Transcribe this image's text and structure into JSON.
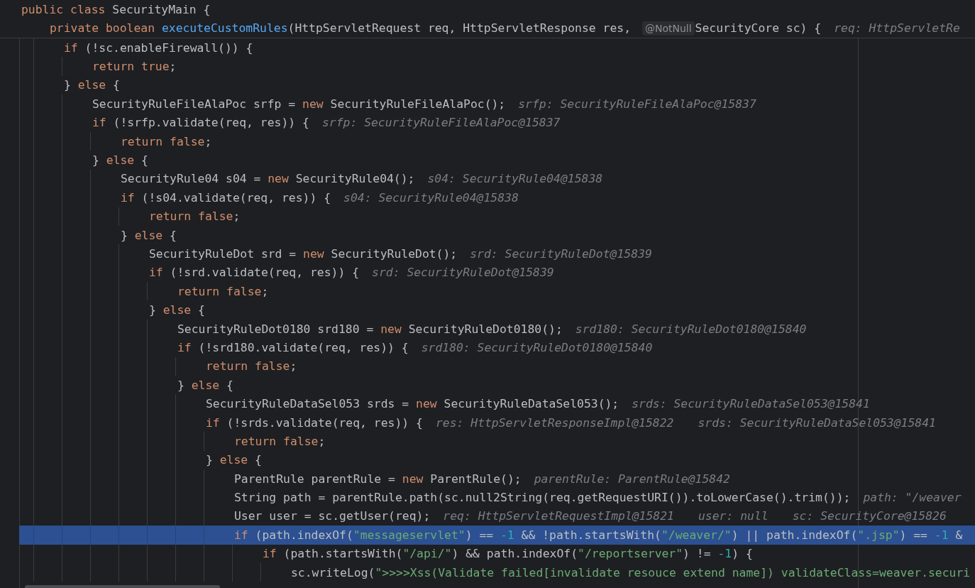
{
  "sticky_header": [
    {
      "segments": [
        {
          "kind": "code",
          "tokens": [
            {
              "kind": "kw",
              "text": "public class "
            },
            {
              "kind": "tx",
              "text": "SecurityMain {"
            }
          ]
        }
      ],
      "children": [
        {
          "segments": [
            {
              "kind": "code",
              "tokens": [
                {
                  "kind": "kw",
                  "text": "private boolean "
                },
                {
                  "kind": "fn",
                  "text": "executeCustomRules"
                },
                {
                  "kind": "tx",
                  "text": "(HttpServletRequest req, HttpServletResponse res, "
                }
              ]
            },
            {
              "kind": "inlay",
              "text": "@NotNull"
            },
            {
              "kind": "code",
              "tokens": [
                {
                  "kind": "tx",
                  "text": "SecurityCore sc) {"
                }
              ]
            },
            {
              "kind": "hint",
              "text": "req: HttpServletRe"
            }
          ]
        }
      ]
    }
  ],
  "lines": [
    {
      "selected": false,
      "segments": [
        {
          "kind": "code",
          "tokens": [
            {
              "kind": "kw",
              "text": "if "
            },
            {
              "kind": "tx",
              "text": "(!sc.enableFirewall()) {"
            }
          ]
        }
      ],
      "children": [
        {
          "selected": false,
          "segments": [
            {
              "kind": "code",
              "tokens": [
                {
                  "kind": "kw",
                  "text": "return true"
                },
                {
                  "kind": "tx",
                  "text": ";"
                }
              ]
            }
          ]
        }
      ]
    },
    {
      "selected": false,
      "segments": [
        {
          "kind": "code",
          "tokens": [
            {
              "kind": "tx",
              "text": "} "
            },
            {
              "kind": "kw",
              "text": "else "
            },
            {
              "kind": "tx",
              "text": "{"
            }
          ]
        }
      ],
      "children": [
        {
          "selected": false,
          "segments": [
            {
              "kind": "code",
              "tokens": [
                {
                  "kind": "tx",
                  "text": "SecurityRuleFileAlaPoc srfp = "
                },
                {
                  "kind": "kw",
                  "text": "new "
                },
                {
                  "kind": "tx",
                  "text": "SecurityRuleFileAlaPoc();"
                }
              ]
            },
            {
              "kind": "hint",
              "text": "srfp: SecurityRuleFileAlaPoc@15837"
            }
          ]
        },
        {
          "selected": false,
          "segments": [
            {
              "kind": "code",
              "tokens": [
                {
                  "kind": "kw",
                  "text": "if "
                },
                {
                  "kind": "tx",
                  "text": "(!srfp.validate(req, res)) {"
                }
              ]
            },
            {
              "kind": "hint",
              "text": "srfp: SecurityRuleFileAlaPoc@15837"
            }
          ],
          "children": [
            {
              "selected": false,
              "segments": [
                {
                  "kind": "code",
                  "tokens": [
                    {
                      "kind": "kw",
                      "text": "return false"
                    },
                    {
                      "kind": "tx",
                      "text": ";"
                    }
                  ]
                }
              ]
            }
          ]
        },
        {
          "selected": false,
          "segments": [
            {
              "kind": "code",
              "tokens": [
                {
                  "kind": "tx",
                  "text": "} "
                },
                {
                  "kind": "kw",
                  "text": "else "
                },
                {
                  "kind": "tx",
                  "text": "{"
                }
              ]
            }
          ],
          "children": [
            {
              "selected": false,
              "segments": [
                {
                  "kind": "code",
                  "tokens": [
                    {
                      "kind": "tx",
                      "text": "SecurityRule04 s04 = "
                    },
                    {
                      "kind": "kw",
                      "text": "new "
                    },
                    {
                      "kind": "tx",
                      "text": "SecurityRule04();"
                    }
                  ]
                },
                {
                  "kind": "hint",
                  "text": "s04: SecurityRule04@15838"
                }
              ]
            },
            {
              "selected": false,
              "segments": [
                {
                  "kind": "code",
                  "tokens": [
                    {
                      "kind": "kw",
                      "text": "if "
                    },
                    {
                      "kind": "tx",
                      "text": "(!s04.validate(req, res)) {"
                    }
                  ]
                },
                {
                  "kind": "hint",
                  "text": "s04: SecurityRule04@15838"
                }
              ],
              "children": [
                {
                  "selected": false,
                  "segments": [
                    {
                      "kind": "code",
                      "tokens": [
                        {
                          "kind": "kw",
                          "text": "return false"
                        },
                        {
                          "kind": "tx",
                          "text": ";"
                        }
                      ]
                    }
                  ]
                }
              ]
            },
            {
              "selected": false,
              "segments": [
                {
                  "kind": "code",
                  "tokens": [
                    {
                      "kind": "tx",
                      "text": "} "
                    },
                    {
                      "kind": "kw",
                      "text": "else "
                    },
                    {
                      "kind": "tx",
                      "text": "{"
                    }
                  ]
                }
              ],
              "children": [
                {
                  "selected": false,
                  "segments": [
                    {
                      "kind": "code",
                      "tokens": [
                        {
                          "kind": "tx",
                          "text": "SecurityRuleDot srd = "
                        },
                        {
                          "kind": "kw",
                          "text": "new "
                        },
                        {
                          "kind": "tx",
                          "text": "SecurityRuleDot();"
                        }
                      ]
                    },
                    {
                      "kind": "hint",
                      "text": "srd: SecurityRuleDot@15839"
                    }
                  ]
                },
                {
                  "selected": false,
                  "segments": [
                    {
                      "kind": "code",
                      "tokens": [
                        {
                          "kind": "kw",
                          "text": "if "
                        },
                        {
                          "kind": "tx",
                          "text": "(!srd.validate(req, res)) {"
                        }
                      ]
                    },
                    {
                      "kind": "hint",
                      "text": "srd: SecurityRuleDot@15839"
                    }
                  ],
                  "children": [
                    {
                      "selected": false,
                      "segments": [
                        {
                          "kind": "code",
                          "tokens": [
                            {
                              "kind": "kw",
                              "text": "return false"
                            },
                            {
                              "kind": "tx",
                              "text": ";"
                            }
                          ]
                        }
                      ]
                    }
                  ]
                },
                {
                  "selected": false,
                  "segments": [
                    {
                      "kind": "code",
                      "tokens": [
                        {
                          "kind": "tx",
                          "text": "} "
                        },
                        {
                          "kind": "kw",
                          "text": "else "
                        },
                        {
                          "kind": "tx",
                          "text": "{"
                        }
                      ]
                    }
                  ],
                  "children": [
                    {
                      "selected": false,
                      "segments": [
                        {
                          "kind": "code",
                          "tokens": [
                            {
                              "kind": "tx",
                              "text": "SecurityRuleDot0180 srd180 = "
                            },
                            {
                              "kind": "kw",
                              "text": "new "
                            },
                            {
                              "kind": "tx",
                              "text": "SecurityRuleDot0180();"
                            }
                          ]
                        },
                        {
                          "kind": "hint",
                          "text": "srd180: SecurityRuleDot0180@15840"
                        }
                      ]
                    },
                    {
                      "selected": false,
                      "segments": [
                        {
                          "kind": "code",
                          "tokens": [
                            {
                              "kind": "kw",
                              "text": "if "
                            },
                            {
                              "kind": "tx",
                              "text": "(!srd180.validate(req, res)) {"
                            }
                          ]
                        },
                        {
                          "kind": "hint",
                          "text": "srd180: SecurityRuleDot0180@15840"
                        }
                      ],
                      "children": [
                        {
                          "selected": false,
                          "segments": [
                            {
                              "kind": "code",
                              "tokens": [
                                {
                                  "kind": "kw",
                                  "text": "return false"
                                },
                                {
                                  "kind": "tx",
                                  "text": ";"
                                }
                              ]
                            }
                          ]
                        }
                      ]
                    },
                    {
                      "selected": false,
                      "segments": [
                        {
                          "kind": "code",
                          "tokens": [
                            {
                              "kind": "tx",
                              "text": "} "
                            },
                            {
                              "kind": "kw",
                              "text": "else "
                            },
                            {
                              "kind": "tx",
                              "text": "{"
                            }
                          ]
                        }
                      ],
                      "children": [
                        {
                          "selected": false,
                          "segments": [
                            {
                              "kind": "code",
                              "tokens": [
                                {
                                  "kind": "tx",
                                  "text": "SecurityRuleDataSel053 srds = "
                                },
                                {
                                  "kind": "kw",
                                  "text": "new "
                                },
                                {
                                  "kind": "tx",
                                  "text": "SecurityRuleDataSel053();"
                                }
                              ]
                            },
                            {
                              "kind": "hint",
                              "text": "srds: SecurityRuleDataSel053@15841"
                            }
                          ]
                        },
                        {
                          "selected": false,
                          "segments": [
                            {
                              "kind": "code",
                              "tokens": [
                                {
                                  "kind": "kw",
                                  "text": "if "
                                },
                                {
                                  "kind": "tx",
                                  "text": "(!srds.validate(req, res)) {"
                                }
                              ]
                            },
                            {
                              "kind": "hint",
                              "text": "res: HttpServletResponseImpl@15822"
                            },
                            {
                              "kind": "hint",
                              "text": "srds: SecurityRuleDataSel053@15841"
                            }
                          ],
                          "children": [
                            {
                              "selected": false,
                              "segments": [
                                {
                                  "kind": "code",
                                  "tokens": [
                                    {
                                      "kind": "kw",
                                      "text": "return false"
                                    },
                                    {
                                      "kind": "tx",
                                      "text": ";"
                                    }
                                  ]
                                }
                              ]
                            }
                          ]
                        },
                        {
                          "selected": false,
                          "segments": [
                            {
                              "kind": "code",
                              "tokens": [
                                {
                                  "kind": "tx",
                                  "text": "} "
                                },
                                {
                                  "kind": "kw",
                                  "text": "else "
                                },
                                {
                                  "kind": "tx",
                                  "text": "{"
                                }
                              ]
                            }
                          ],
                          "children": [
                            {
                              "selected": false,
                              "segments": [
                                {
                                  "kind": "code",
                                  "tokens": [
                                    {
                                      "kind": "tx",
                                      "text": "ParentRule parentRule = "
                                    },
                                    {
                                      "kind": "kw",
                                      "text": "new "
                                    },
                                    {
                                      "kind": "tx",
                                      "text": "ParentRule();"
                                    }
                                  ]
                                },
                                {
                                  "kind": "hint",
                                  "text": "parentRule: ParentRule@15842"
                                }
                              ]
                            },
                            {
                              "selected": false,
                              "segments": [
                                {
                                  "kind": "code",
                                  "tokens": [
                                    {
                                      "kind": "tx",
                                      "text": "String path = parentRule.path(sc.null2String(req.getRequestURI()).toLowerCase().trim());"
                                    }
                                  ]
                                },
                                {
                                  "kind": "hint",
                                  "text": "path: \"/weaver"
                                }
                              ]
                            },
                            {
                              "selected": false,
                              "segments": [
                                {
                                  "kind": "code",
                                  "tokens": [
                                    {
                                      "kind": "tx",
                                      "text": "User user = sc.getUser(req);"
                                    }
                                  ]
                                },
                                {
                                  "kind": "hint",
                                  "text": "req: HttpServletRequestImpl@15821"
                                },
                                {
                                  "kind": "hint",
                                  "text": "user: null"
                                },
                                {
                                  "kind": "hint",
                                  "text": "sc: SecurityCore@15826"
                                }
                              ]
                            },
                            {
                              "selected": true,
                              "segments": [
                                {
                                  "kind": "code",
                                  "tokens": [
                                    {
                                      "kind": "kw",
                                      "text": "if "
                                    },
                                    {
                                      "kind": "tx",
                                      "text": "(path.indexOf("
                                    },
                                    {
                                      "kind": "str",
                                      "text": "\"messageservlet\""
                                    },
                                    {
                                      "kind": "tx",
                                      "text": ") == "
                                    },
                                    {
                                      "kind": "num",
                                      "text": "-1"
                                    },
                                    {
                                      "kind": "tx",
                                      "text": " && !path.startsWith("
                                    },
                                    {
                                      "kind": "str",
                                      "text": "\"/weaver/\""
                                    },
                                    {
                                      "kind": "tx",
                                      "text": ") || path.indexOf("
                                    },
                                    {
                                      "kind": "str",
                                      "text": "\".jsp\""
                                    },
                                    {
                                      "kind": "tx",
                                      "text": ") == "
                                    },
                                    {
                                      "kind": "num",
                                      "text": "-1"
                                    },
                                    {
                                      "kind": "tx",
                                      "text": " &"
                                    }
                                  ]
                                }
                              ],
                              "children": [
                                {
                                  "selected": false,
                                  "segments": [
                                    {
                                      "kind": "code",
                                      "tokens": [
                                        {
                                          "kind": "kw",
                                          "text": "if "
                                        },
                                        {
                                          "kind": "tx",
                                          "text": "(path.startsWith("
                                        },
                                        {
                                          "kind": "str",
                                          "text": "\"/api/\""
                                        },
                                        {
                                          "kind": "tx",
                                          "text": ") && path.indexOf("
                                        },
                                        {
                                          "kind": "str",
                                          "text": "\"/reportserver\""
                                        },
                                        {
                                          "kind": "tx",
                                          "text": ") != "
                                        },
                                        {
                                          "kind": "num",
                                          "text": "-1"
                                        },
                                        {
                                          "kind": "tx",
                                          "text": ") {"
                                        }
                                      ]
                                    }
                                  ],
                                  "children": [
                                    {
                                      "selected": false,
                                      "segments": [
                                        {
                                          "kind": "code",
                                          "tokens": [
                                            {
                                              "kind": "tx",
                                              "text": "sc.writeLog("
                                            },
                                            {
                                              "kind": "str",
                                              "text": "\">>>>Xss(Validate failed[invalidate resouce extend name]) validateClass=weaver.securi"
                                            }
                                          ]
                                        }
                                      ]
                                    }
                                  ]
                                }
                              ]
                            }
                          ]
                        }
                      ]
                    }
                  ]
                }
              ]
            }
          ]
        }
      ]
    }
  ]
}
